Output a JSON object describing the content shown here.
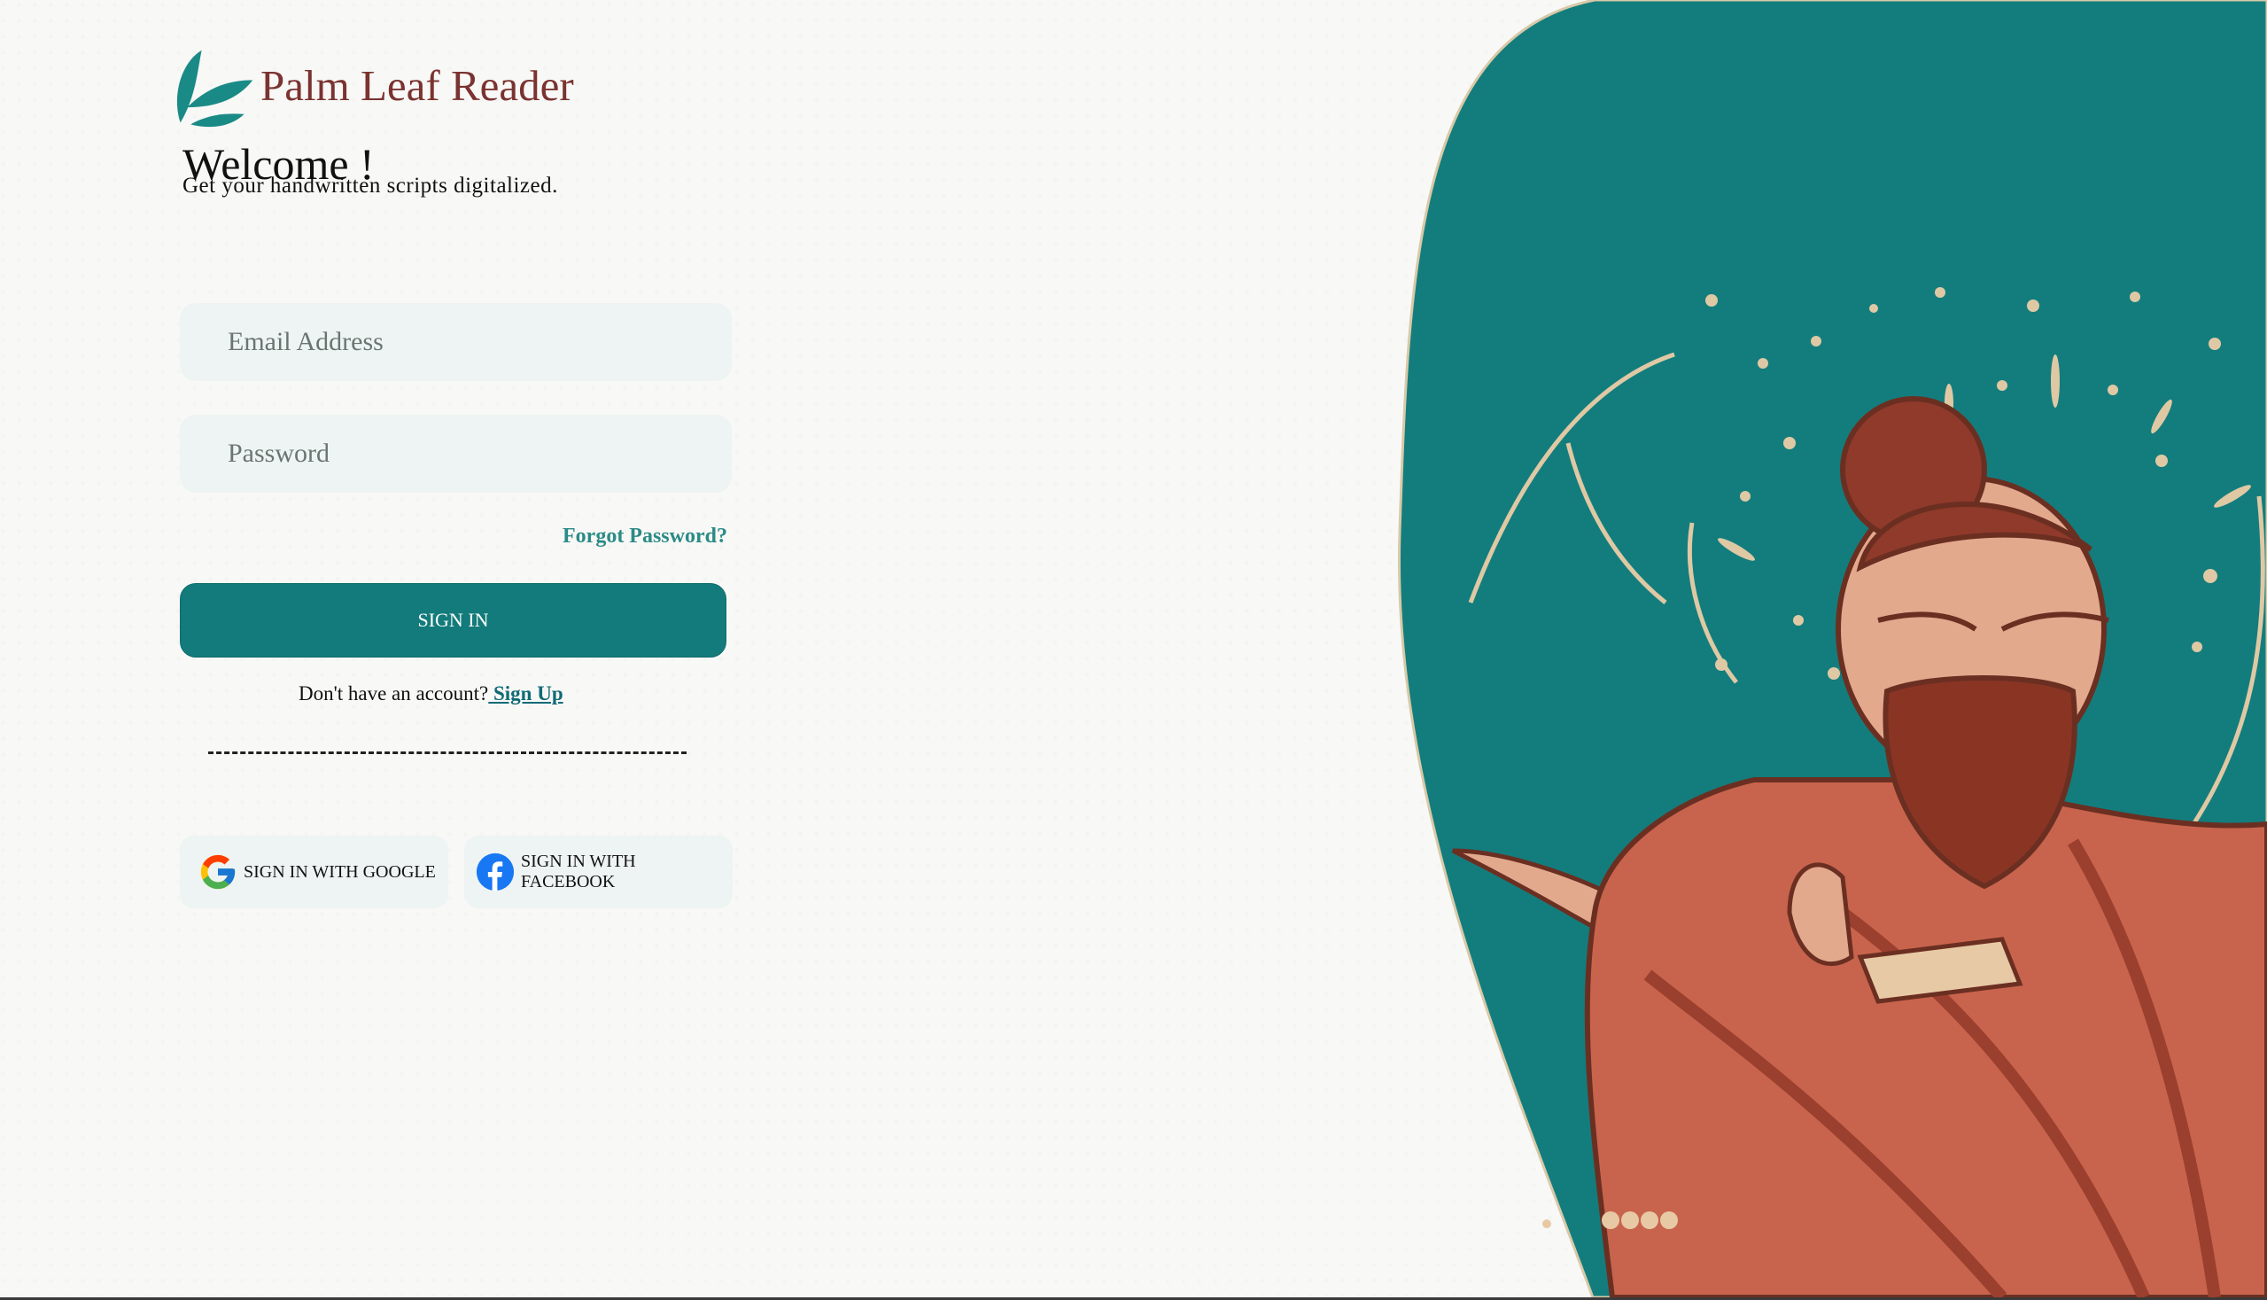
{
  "brand": {
    "name": "Palm Leaf Reader",
    "logo_icon": "palm-leaf-logo-icon"
  },
  "welcome": {
    "title": "Welcome !",
    "subtitle": "Get your handwritten scripts digitalized."
  },
  "form": {
    "email_placeholder": "Email Address",
    "password_placeholder": "Password",
    "forgot_label": "Forgot Password?",
    "signin_label": "SIGN IN",
    "no_account_text": "Don't have an account?",
    "signup_label": " Sign Up",
    "divider_text": ""
  },
  "social": {
    "google_label": "SIGN IN WITH GOOGLE",
    "facebook_label": "SIGN IN WITH FACEBOOK",
    "google_icon": "google-icon",
    "facebook_icon": "facebook-icon"
  },
  "colors": {
    "accent": "#137b7b",
    "brand_text": "#7a3330",
    "link": "#2b8b86",
    "field_bg": "#eef4f3"
  }
}
